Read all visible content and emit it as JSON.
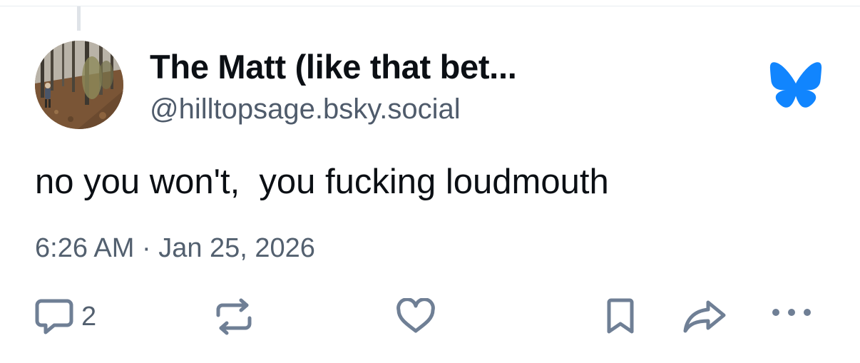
{
  "author": {
    "display_name": "The Matt (like that bet...",
    "handle": "@hilltopsage.bsky.social",
    "avatar": "avatar-photo-hiker-in-forest"
  },
  "post": {
    "text": "no you won't,  you fucking loudmouth",
    "timestamp": "6:26 AM · Jan 25, 2026"
  },
  "actions": {
    "reply_count": "2",
    "reply_icon": "speech-bubble-icon",
    "repost_icon": "repost-icon",
    "like_icon": "heart-icon",
    "bookmark_icon": "bookmark-icon",
    "share_icon": "share-arrow-icon",
    "more_icon": "ellipsis-icon"
  },
  "brand": {
    "logo": "bluesky-butterfly-icon",
    "color": "#1185fe"
  },
  "colors": {
    "text_primary": "#0b0f14",
    "text_secondary": "#53606f",
    "icon": "#6f7f95"
  }
}
